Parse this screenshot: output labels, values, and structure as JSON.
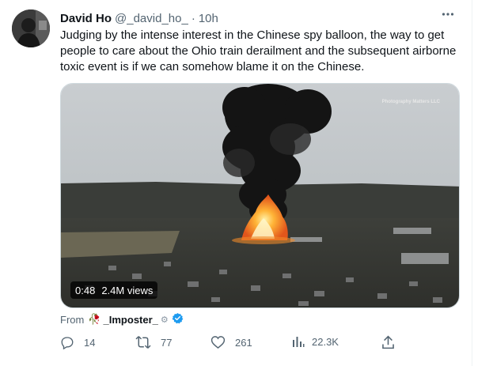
{
  "tweet": {
    "author_name": "David Ho",
    "author_handle": "@_david_ho_",
    "separator": "·",
    "timestamp": "10h",
    "text": "Judging by the intense interest in the Chinese spy balloon, the way to get people to care about the Ohio train derailment and the subsequent airborne toxic event is if we can somehow blame it on the Chinese."
  },
  "media": {
    "watermark": "Photography Matters LLC",
    "duration": "0:48",
    "views": "2.4M views"
  },
  "source": {
    "from_label": "From",
    "account": "_Imposter_",
    "emoji": "🥀",
    "gear": "⚙"
  },
  "actions": {
    "replies": "14",
    "retweets": "77",
    "likes": "261",
    "views": "22.3K"
  },
  "colors": {
    "secondary_text": "#536471",
    "verified": "#1d9bf0",
    "smoke": "#141414",
    "fire": "#ff7a1a"
  },
  "icons": [
    "more-icon",
    "reply-icon",
    "retweet-icon",
    "like-icon",
    "views-icon",
    "share-icon",
    "verified-badge-icon"
  ]
}
